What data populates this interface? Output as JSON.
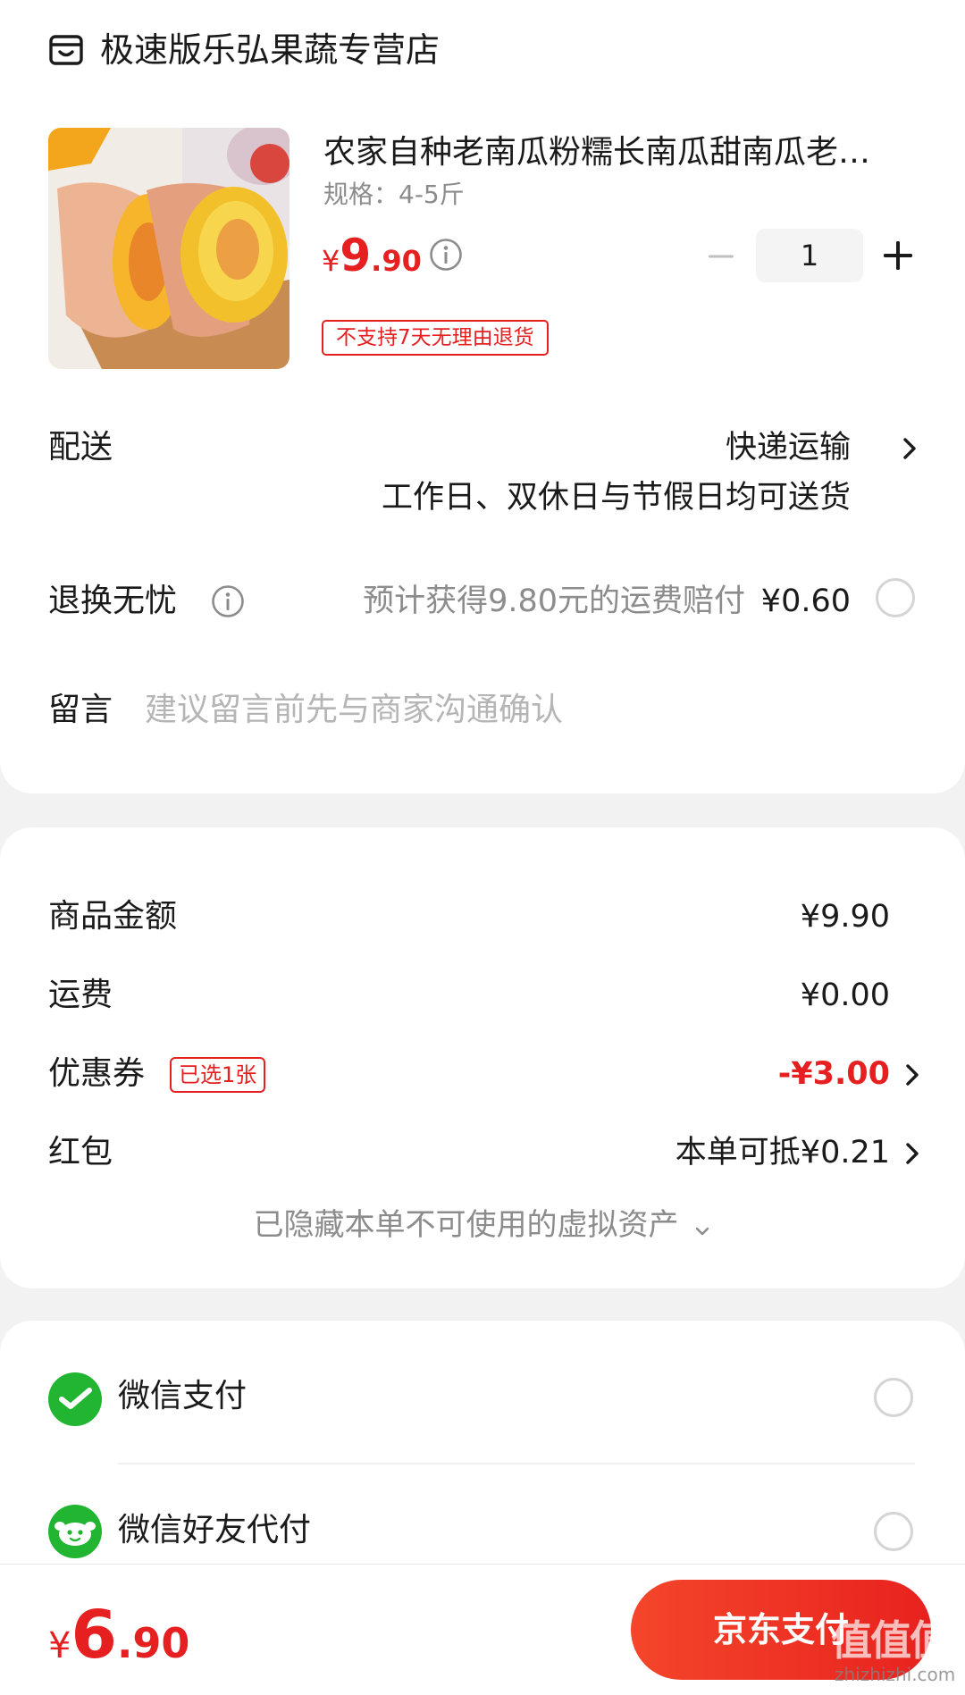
{
  "store": {
    "name": "极速版乐弘果蔬专营店",
    "icon": "store-icon"
  },
  "product": {
    "title": "农家自种老南瓜粉糯长南瓜甜南瓜老…",
    "spec": "规格：4-5斤",
    "price": {
      "currency": "¥",
      "integer": "9",
      "decimal": ".90"
    },
    "quantity": "1",
    "return_policy_badge": "不支持7天无理由退货"
  },
  "delivery": {
    "label": "配送",
    "method": "快递运输",
    "schedule": "工作日、双休日与节假日均可送货"
  },
  "return_insurance": {
    "label": "退换无忧",
    "description": "预计获得9.80元的运费赔付",
    "price": "¥0.60"
  },
  "message": {
    "label": "留言",
    "placeholder": "建议留言前先与商家沟通确认"
  },
  "summary": {
    "goods_amount_label": "商品金额",
    "goods_amount": "¥9.90",
    "shipping_label": "运费",
    "shipping": "¥0.00",
    "coupon_label": "优惠券",
    "coupon_badge": "已选1张",
    "coupon_value": "-¥3.00",
    "red_packet_label": "红包",
    "red_packet_value": "本单可抵¥0.21",
    "hidden_assets": "已隐藏本单不可使用的虚拟资产"
  },
  "payment_methods": [
    {
      "label": "微信支付",
      "icon": "wechat-pay-icon"
    },
    {
      "label": "微信好友代付",
      "icon": "wechat-friend-pay-icon"
    }
  ],
  "footer": {
    "total": {
      "currency": "¥",
      "integer": "6",
      "decimal": ".90"
    },
    "pay_button": "京东支付"
  },
  "watermark": {
    "text": "值值值",
    "url": "zhizhizhi.com"
  },
  "colors": {
    "accent": "#e62020",
    "wechat_green": "#21b532"
  }
}
